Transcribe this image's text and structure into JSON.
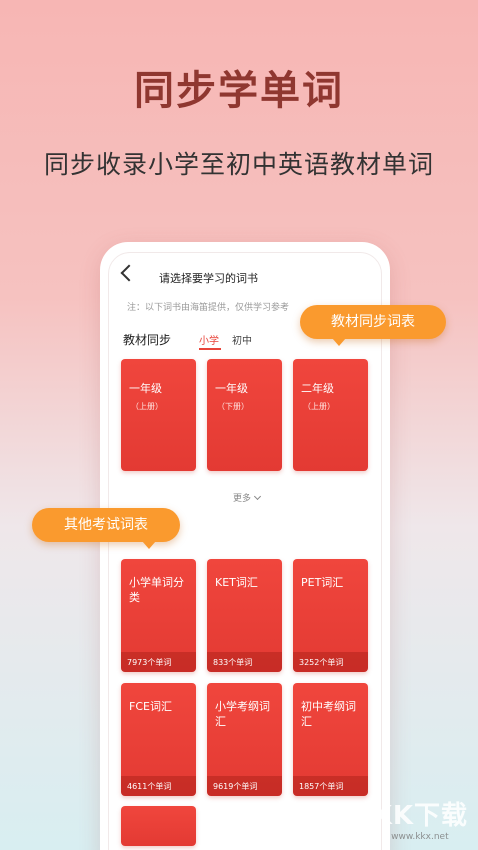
{
  "hero": {
    "title": "同步学单词",
    "subtitle": "同步收录小学至初中英语教材单词"
  },
  "screen": {
    "title": "请选择要学习的词书",
    "note": "注：以下词书由海笛提供，仅供学习参考",
    "section_label": "教材同步",
    "tabs": [
      {
        "label": "小学",
        "active": true
      },
      {
        "label": "初中",
        "active": false
      }
    ],
    "textbooks": [
      {
        "title": "一年级",
        "sub": "（上册）"
      },
      {
        "title": "一年级",
        "sub": "（下册）"
      },
      {
        "title": "二年级",
        "sub": "（上册）"
      }
    ],
    "more_label": "更多",
    "exams": [
      {
        "title": "小学单词分类",
        "count": "7973个单词"
      },
      {
        "title": "KET词汇",
        "count": "833个单词"
      },
      {
        "title": "PET词汇",
        "count": "3252个单词"
      },
      {
        "title": "FCE词汇",
        "count": "4611个单词"
      },
      {
        "title": "小学考纲词汇",
        "count": "9619个单词"
      },
      {
        "title": "初中考纲词汇",
        "count": "1857个单词"
      }
    ]
  },
  "bubbles": {
    "textbook_sync": "教材同步词表",
    "other_exams": "其他考试词表"
  },
  "watermark": {
    "logo": "KK下载",
    "url": "www.kkx.net"
  },
  "colors": {
    "accent": "#e8443a",
    "card_red": "#ef453c",
    "bubble_orange": "#fa9a2e",
    "title_brown": "#8f3730"
  }
}
